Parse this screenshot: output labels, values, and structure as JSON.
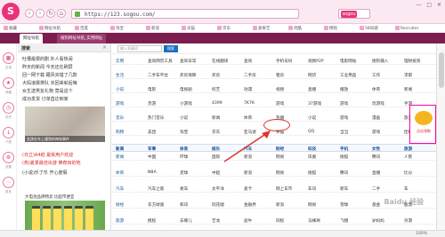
{
  "browser": {
    "url": "https://123.sogou.com/",
    "search_engine": "sogou",
    "window_controls": "— □ ✕"
  },
  "bookmarks": [
    "收藏",
    "网址导航",
    "百度",
    "淘宝",
    "新浪",
    "天猫",
    "京东",
    "爱奇艺",
    "优酷",
    "携程",
    "58同城",
    "Recruiter"
  ],
  "tabs": [
    "网址导航",
    "搜狗网址导航_实用网址"
  ],
  "left_sidebar": [
    "应用",
    "收藏",
    "历史",
    "下载",
    "设置",
    "更多"
  ],
  "news_panel": {
    "title": "搜索",
    "lines": [
      "吐槽最狠的剧 外人看热闹",
      "昨天的新闻 今天还在刷屏",
      "回一网下载 跟风买错了几款",
      "大妈凌晨排队 买回来就后悔",
      "女生送男友礼物 竟是这个",
      "成功发货 订单直达到家"
    ],
    "photo_caption": "女孩在车上遇到的神秘事件",
    "red_lines": [
      "(日立)A4纸 最受用户欢迎",
      "(热)夏季最佳出游 推荐目的地"
    ],
    "bottom_lines": [
      "(小说)乐了乐 开心度假"
    ],
    "ad_title": "大电池品牌特卖 比超市便宜"
  },
  "top_search": {
    "placeholder": "输入关键词",
    "button": "搜索"
  },
  "rows": [
    [
      "实用",
      "查询网页工具",
      "查询日常",
      "在线翻译",
      "查询",
      "手机号码",
      "视频P2P",
      "电影网站",
      "搜狗输入",
      "理财投资"
    ],
    [
      "生活",
      "二手车平台",
      "买房保障",
      "买房",
      "二手房",
      "租房",
      "网贷",
      "工业用品",
      "工作",
      "求职"
    ],
    [
      "小说",
      "电影",
      "电视剧",
      "综艺",
      "动漫",
      "视频",
      "直播",
      "播放",
      "体育",
      "新闻"
    ],
    [
      "游戏",
      "页游",
      "小游戏",
      "4399",
      "7K7K",
      "游戏",
      "37游戏",
      "游戏",
      "玩游戏",
      "手游"
    ],
    [
      "音乐",
      "热门音乐",
      "小说",
      "新闻",
      "体育",
      "热播",
      "小说",
      "游戏",
      "漫画",
      "旅游"
    ],
    [
      "购物",
      "美团",
      "淘宝",
      "京东",
      "亚马逊",
      "天猫",
      "QQ",
      "当当",
      "游戏",
      "团购"
    ]
  ],
  "section2": [
    "新闻",
    "军事",
    "体育",
    "娱乐",
    "汽车",
    "财经",
    "科技",
    "手机",
    "女性",
    "旅游"
  ],
  "rows2": [
    [
      "新闻",
      "中国",
      "环球",
      "国际",
      "新浪",
      "网易",
      "凤凰",
      "搜狐",
      "腾讯",
      "人民"
    ],
    [
      "体育",
      "NBA",
      "足球",
      "中超",
      "新浪",
      "网易",
      "搜狐",
      "腾讯",
      "直播",
      "比分"
    ],
    [
      "汽车",
      "汽车之家",
      "易车",
      "太平洋",
      "爱卡",
      "网上车市",
      "车讯",
      "新车",
      "二手",
      "车"
    ],
    [
      "财经",
      "东方财富",
      "和讯",
      "同花顺",
      "金融界",
      "新浪",
      "网易",
      "雪球",
      "基金",
      "股票"
    ],
    [
      "旅游",
      "携程",
      "去哪儿",
      "艺龙",
      "途牛",
      "同程",
      "马蜂窝",
      "飞猪",
      "驴妈妈",
      "穷游"
    ]
  ],
  "float_ad": "点击领取",
  "status": {
    "zoom": "100%"
  },
  "watermark": "Baidu 经验",
  "colors": {
    "brand": "#e8337c",
    "link": "#1a4f9c",
    "highlight": "#d91e1e"
  }
}
